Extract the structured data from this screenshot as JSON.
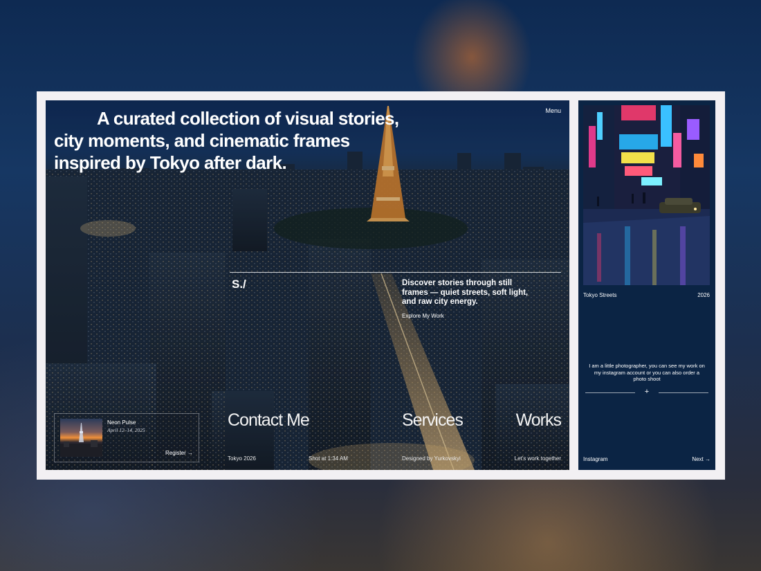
{
  "hero": {
    "headline": "A curated collection of visual stories, city moments, and cinematic frames inspired by Tokyo after dark.",
    "menu_label": "Menu",
    "logo": "S./",
    "discover_text": "Discover stories through still frames — quiet streets, soft light, and raw city energy.",
    "explore_label": "Explore My Work"
  },
  "event": {
    "title": "Neon Pulse",
    "date": "April 12–14, 2025",
    "register_label": "Register →"
  },
  "nav": {
    "contact": "Contact Me",
    "services": "Services",
    "works": "Works"
  },
  "footer": {
    "location": "Tokyo 2026",
    "shot_time": "Shot at 1:34 AM",
    "designer": "Designed by Yurkovskyi",
    "cta": "Let's work together"
  },
  "side": {
    "caption_title": "Tokyo Streets",
    "caption_year": "2026",
    "bio": "I am a little photographer, you can see my work on my instagram account or you can also order a photo shoot",
    "plus_icon": "+",
    "instagram_label": "Instagram",
    "next_label": "Next →"
  },
  "colors": {
    "frame": "#f2f0f3",
    "side_panel": "#0b2444",
    "tower_orange": "#f0903a"
  }
}
